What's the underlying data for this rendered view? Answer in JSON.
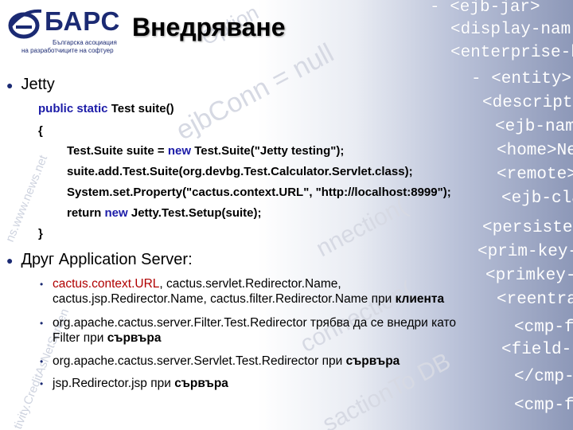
{
  "logo": {
    "wordmark": "БАРС",
    "tagline_line1": "Българска асоциация",
    "tagline_line2": "на разработчиците на софтуер"
  },
  "title": "Внедряване",
  "bullet1": {
    "label": "Jetty"
  },
  "code": {
    "l1_kw": "public static",
    "l1_rest": " Test suite()",
    "l2": "{",
    "l3_a": "Test.Suite suite = ",
    "l3_kw": "new",
    "l3_b": " Test.Suite(\"Jetty testing\");",
    "l4": "suite.add.Test.Suite(org.devbg.Test.Calculator.Servlet.class);",
    "l5": "System.set.Property(\"cactus.context.URL\",  \"http://localhost:8999\");",
    "l6_a": "return ",
    "l6_kw": "new",
    "l6_b": " Jetty.Test.Setup(suite);",
    "l7": "}"
  },
  "bullet2": {
    "label": "Друг Application Server:"
  },
  "subs": [
    {
      "line1_red": "cactus.context.URL",
      "line1_rest": ", cactus.servlet.Redirector.Name,",
      "line2_a": "cactus.jsp.Redirector.Name, cactus.filter.Redirector.Name  при ",
      "line2_b": "клиента"
    },
    {
      "line1": "org.apache.cactus.server.Filter.Test.Redirector трябва да се внедри като",
      "line2_a": "Filter при ",
      "line2_b": "сървъра"
    },
    {
      "line1_a": "org.apache.cactus.server.Servlet.Test.Redirector",
      "line1_b": " при ",
      "line1_c": "сървъра"
    },
    {
      "line1_a": "jsp.Redirector.jsp",
      "line1_b": " при ",
      "line1_c": "сървъра"
    }
  ],
  "watermark": {
    "right_tags": [
      "- <ejb-jar>",
      "<display-nam",
      "<enterprise-b",
      "- <entity>",
      "<description",
      "<ejb-name",
      "<home>Ne",
      "<remote>",
      "<ejb-clas",
      "<persistence",
      "<prim-key-c",
      "<primkey-f",
      "<reentran",
      "<cmp-fiel",
      "<field-nar",
      "</cmp-field",
      "<cmp-field"
    ],
    "diag": [
      "Option",
      "ejbConn = null",
      "nnection(",
      "connection(",
      "sactionTo DB"
    ],
    "left": [
      "ns.www.news.net",
      "tivity.CreditAsNetScreen"
    ]
  }
}
